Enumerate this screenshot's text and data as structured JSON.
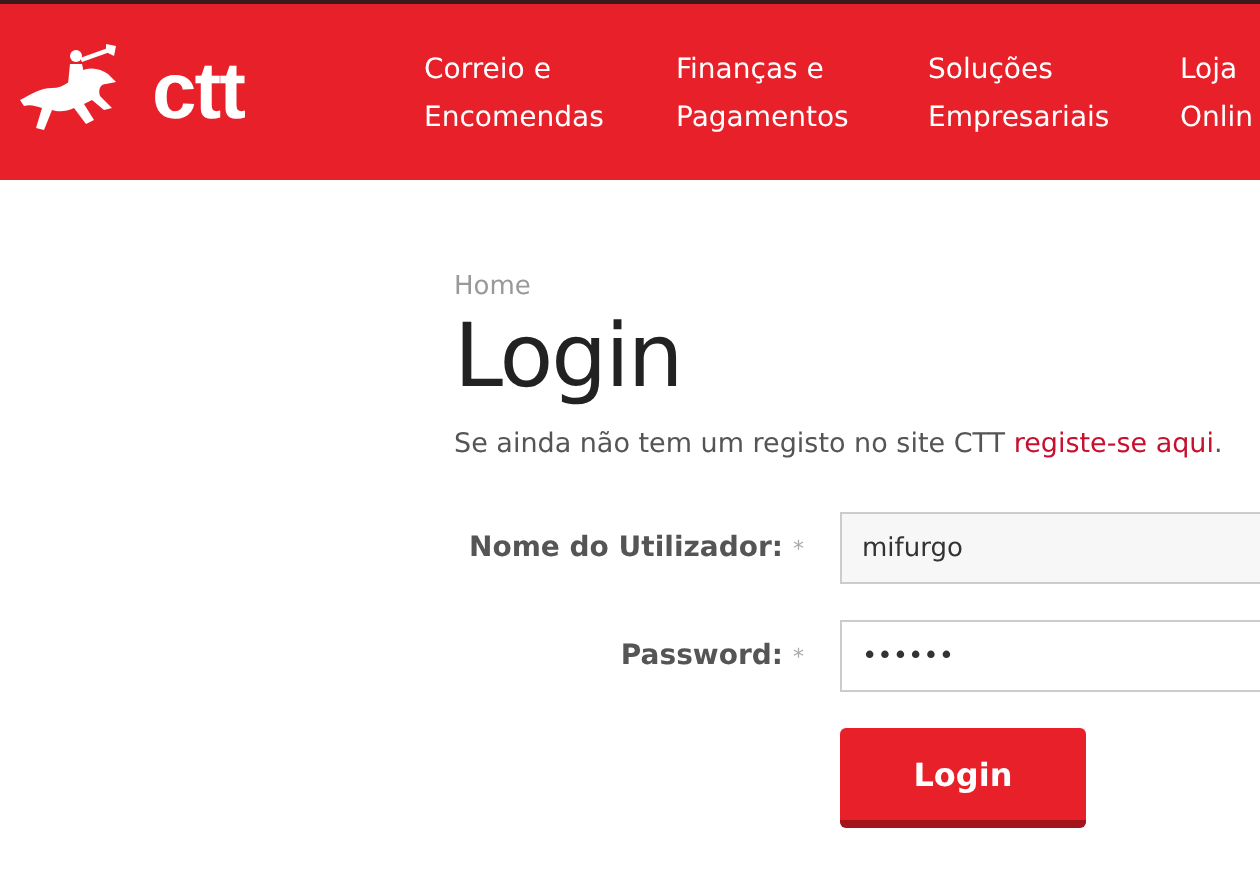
{
  "header": {
    "logo_text": "ctt",
    "nav": [
      {
        "label": "Correio e Encomendas"
      },
      {
        "label": "Finanças e Pagamentos"
      },
      {
        "label": "Soluções Empresariais"
      },
      {
        "label": "Loja Onlin"
      }
    ]
  },
  "breadcrumb": "Home",
  "title": "Login",
  "intro": {
    "text": "Se ainda não tem um registo no site CTT",
    "link": "registe-se aqui",
    "end": "."
  },
  "fields": [
    {
      "label": "Nome do Utilizador:",
      "marker": "*",
      "value": "mifurgo"
    },
    {
      "label": "Password:",
      "marker": "*",
      "value": "••••••"
    }
  ],
  "submit": "Login"
}
